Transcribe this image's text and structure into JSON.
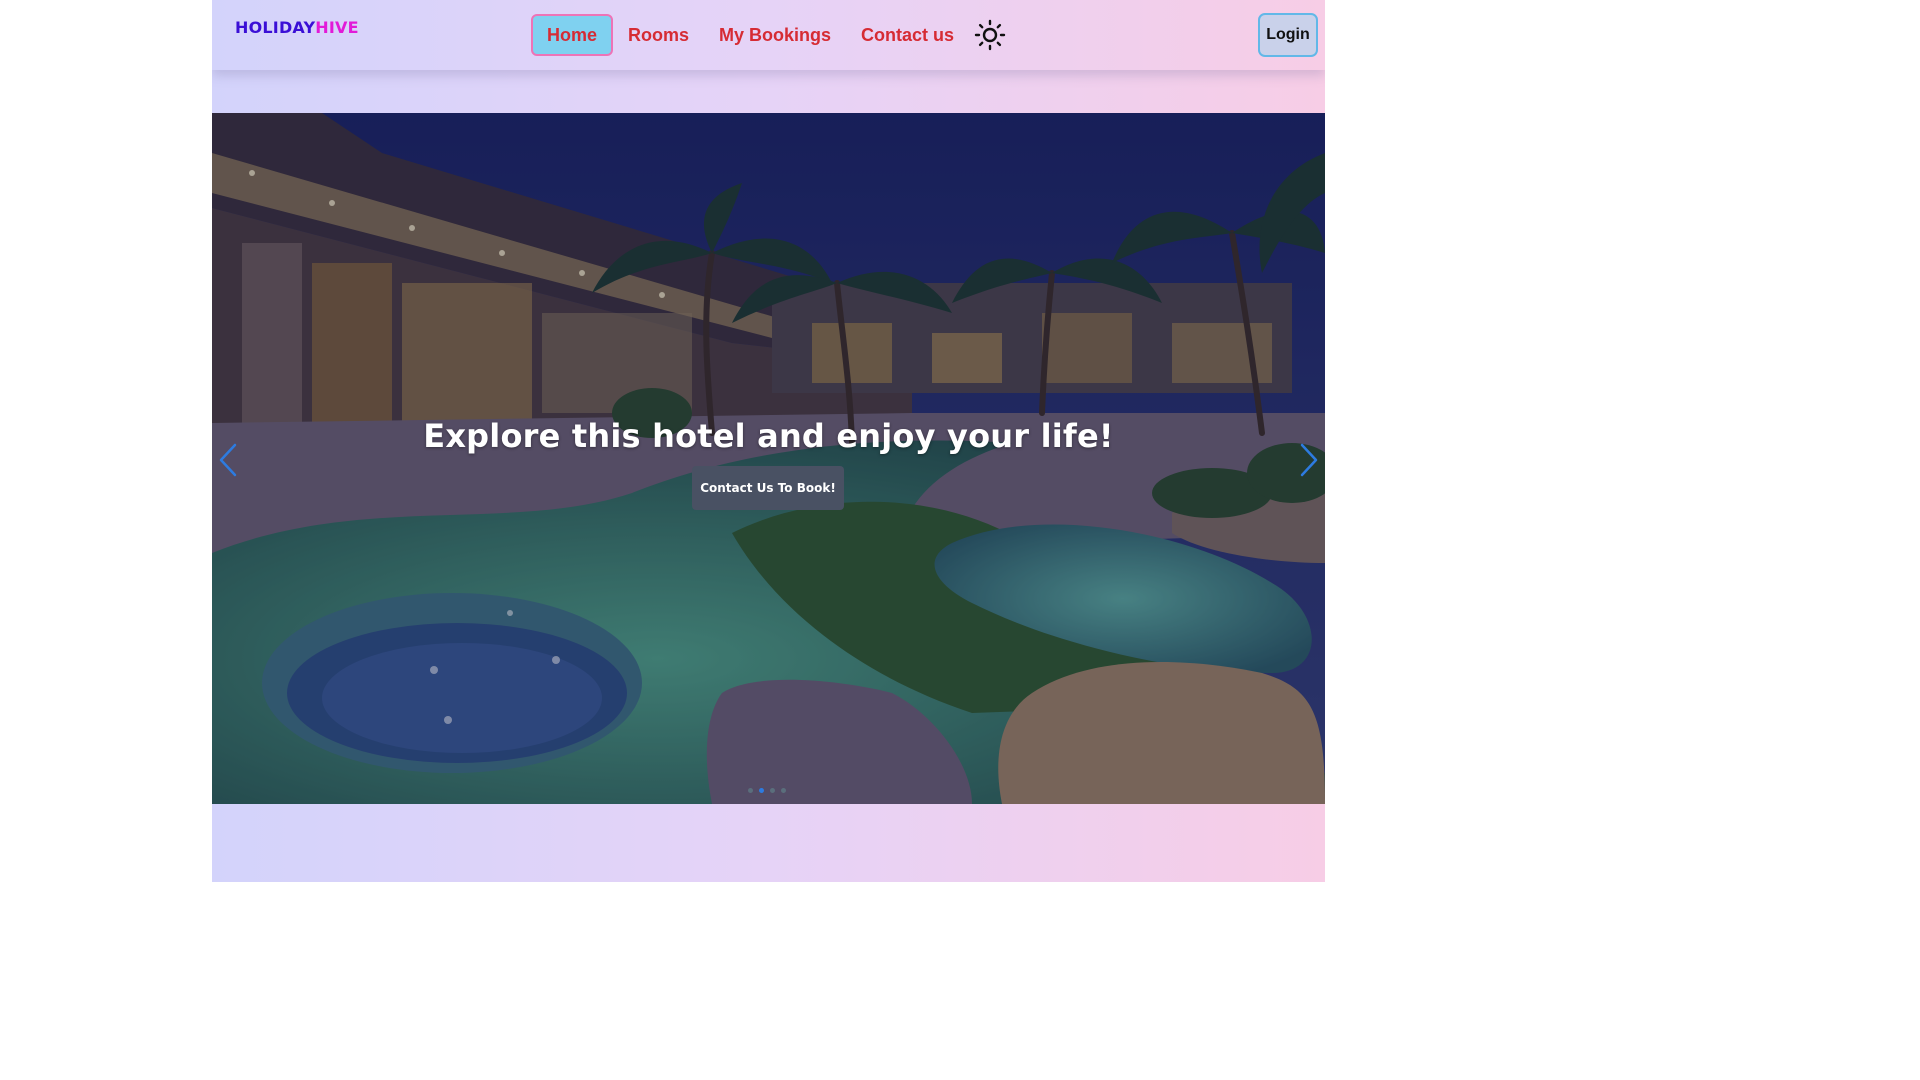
{
  "brand": {
    "part1": "HOLIDAY",
    "part2": "HIVE"
  },
  "nav": {
    "items": [
      {
        "label": "Home",
        "active": true
      },
      {
        "label": "Rooms",
        "active": false
      },
      {
        "label": "My Bookings",
        "active": false
      },
      {
        "label": "Contact us",
        "active": false
      }
    ],
    "theme_toggle_icon": "sun-icon"
  },
  "login_label": "Login",
  "hero": {
    "title": "Explore this hotel and enjoy your life!",
    "cta_label": "Contact Us To Book!",
    "prev_icon": "chevron-left-icon",
    "next_icon": "chevron-right-icon",
    "slide_count": 4,
    "active_slide": 2
  },
  "colors": {
    "nav_link": "#d62b34",
    "active_bg": "#7fd1f0",
    "active_border": "#ee73b7",
    "logo_primary": "#3b0fd6",
    "logo_accent": "#e21ad8",
    "carousel_control": "#2d7be0"
  }
}
